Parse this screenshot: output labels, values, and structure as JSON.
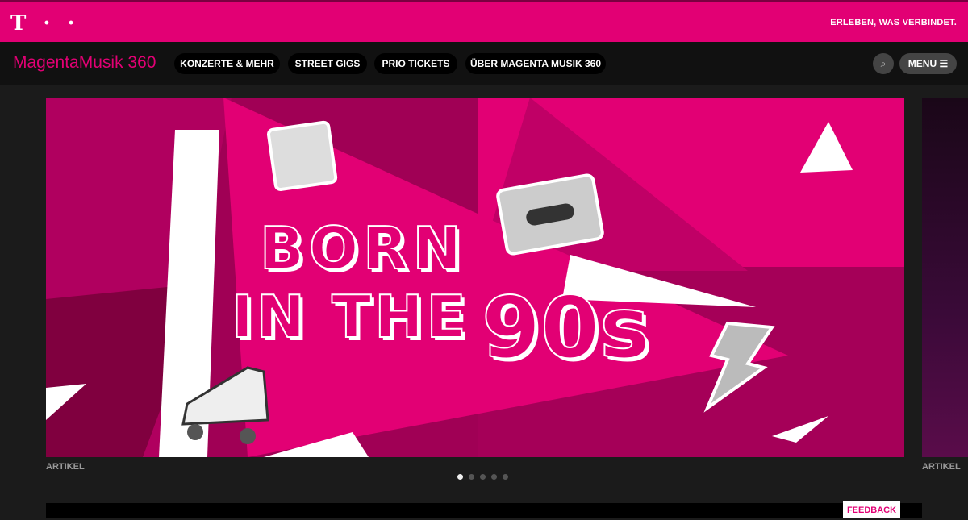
{
  "header": {
    "logo": "T · ·",
    "slogan": "ERLEBEN, WAS VERBINDET."
  },
  "nav": {
    "brand_a": "Magenta",
    "brand_b": "Musik 360",
    "items": [
      "KONZERTE & MEHR",
      "STREET GIGS",
      "PRIO TICKETS",
      "ÜBER MAGENTA MUSIK 360"
    ],
    "search_icon": "search-icon",
    "menu": "MENU ☰"
  },
  "carousel": {
    "slide": {
      "line1": "BORN",
      "line2": "IN THE",
      "line3": "90s",
      "label": "ARTIKEL"
    },
    "next_label": "ARTIKEL",
    "dots": 5,
    "active_dot": 1
  },
  "feedback": "FEEDBACK",
  "colors": {
    "magenta": "#e20074"
  }
}
